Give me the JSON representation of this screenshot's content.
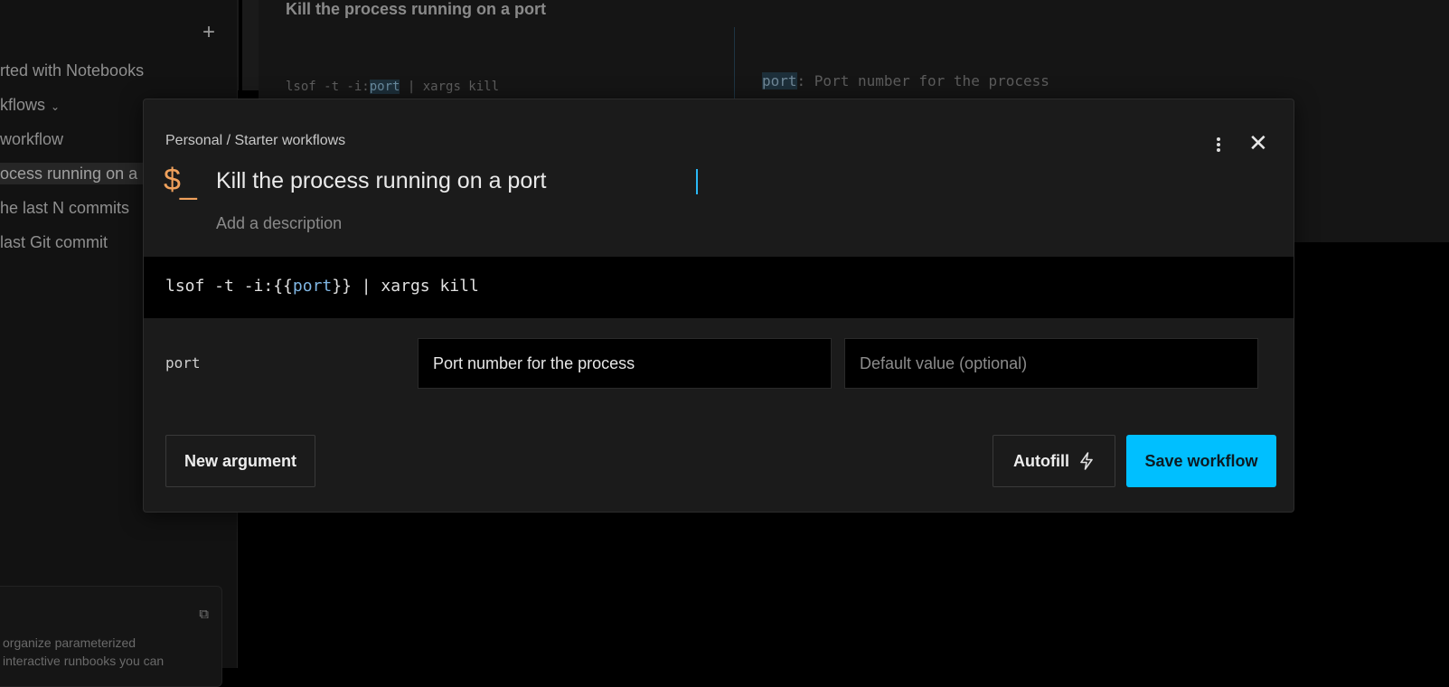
{
  "sidebar": {
    "items": [
      {
        "label": "rted with Notebooks"
      },
      {
        "label": "kflows"
      },
      {
        "label": "workflow"
      },
      {
        "label": "ocess running on a"
      },
      {
        "label": "he last N commits"
      },
      {
        "label": "last Git commit"
      }
    ],
    "card_text_line1": "organize parameterized",
    "card_text_line2": "interactive runbooks you can"
  },
  "background": {
    "title": "Kill the process running on a port",
    "code_prefix": "lsof -t -i:",
    "code_arg": "port",
    "code_suffix": " | xargs kill",
    "arg_name": "port",
    "arg_desc": ": Port number for the process"
  },
  "modal": {
    "breadcrumb": "Personal / Starter workflows",
    "icon_dollar": "$",
    "icon_underscore": "_",
    "title_value": "Kill the process running on a port",
    "description_placeholder": "Add a description",
    "command": {
      "prefix": "lsof -t -i:{{",
      "arg": "port",
      "suffix": "}} | xargs kill"
    },
    "argument": {
      "name": "port",
      "description_value": "Port number for the process",
      "default_placeholder": "Default value (optional)"
    },
    "buttons": {
      "new_argument": "New argument",
      "autofill": "Autofill",
      "save": "Save workflow"
    },
    "close_glyph": "✕"
  },
  "colors": {
    "accent": "#00bfff",
    "icon_orange": "#f0a15c",
    "arg_blue": "#7fb6e3"
  }
}
